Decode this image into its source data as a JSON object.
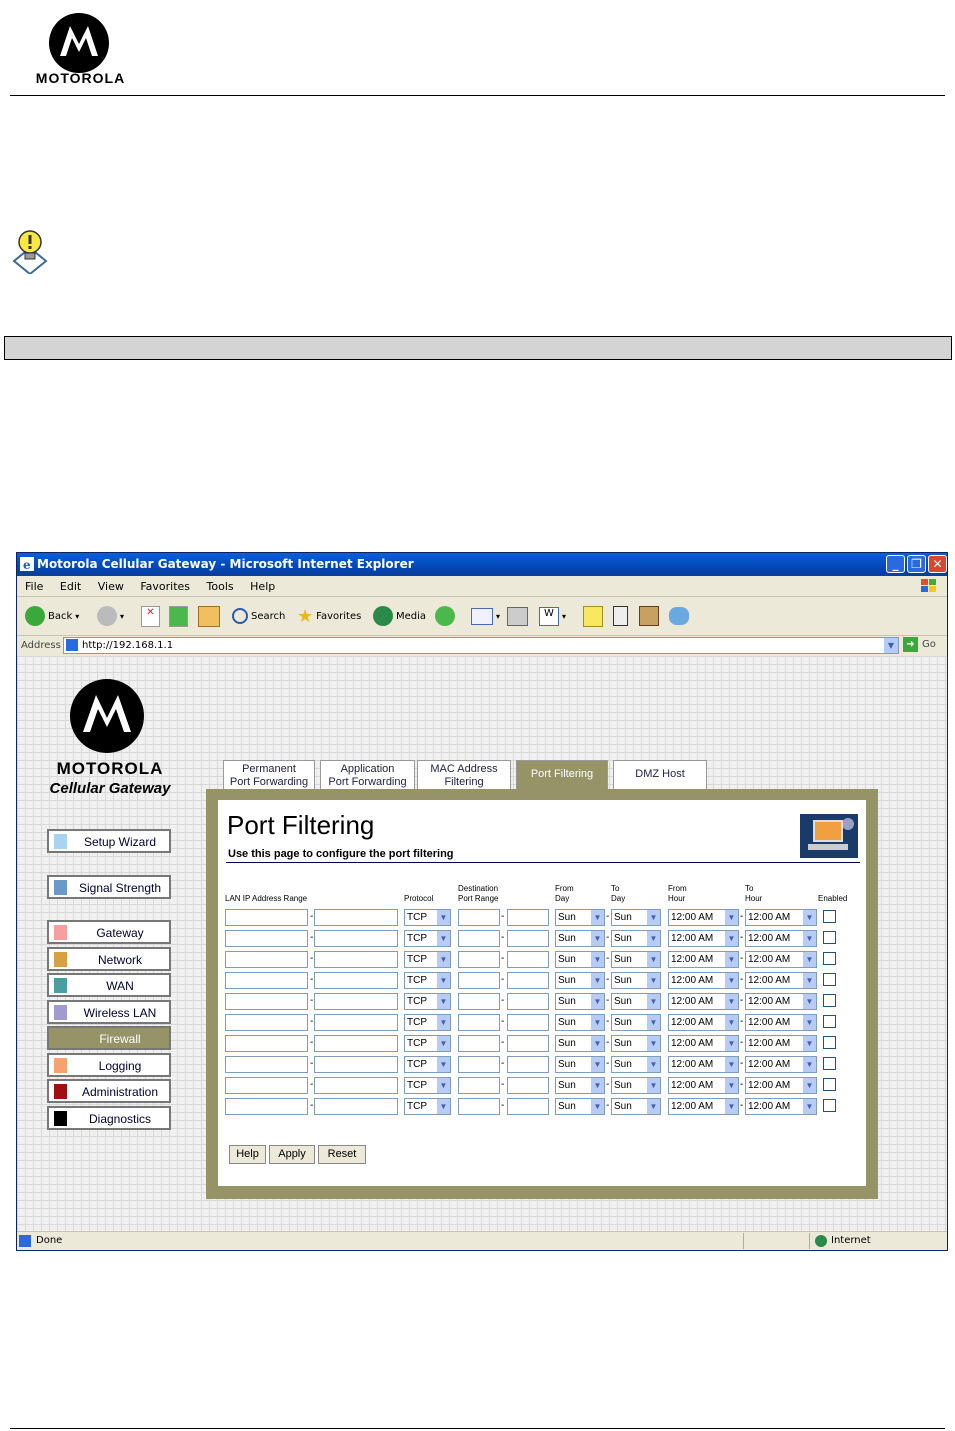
{
  "document": {
    "brand": "MOTOROLA"
  },
  "browser": {
    "title": "Motorola Cellular Gateway - Microsoft Internet Explorer",
    "menu": [
      "File",
      "Edit",
      "View",
      "Favorites",
      "Tools",
      "Help"
    ],
    "toolbar": {
      "back": "Back",
      "search": "Search",
      "favorites": "Favorites",
      "media": "Media"
    },
    "address_label": "Address",
    "address": "http://192.168.1.1",
    "go_label": "Go",
    "status": "Done",
    "zone": "Internet"
  },
  "sidebar": {
    "brand": "MOTOROLA",
    "subtitle": "Cellular Gateway",
    "items": [
      {
        "label": "Setup Wizard",
        "color": "#a8d4f2"
      },
      {
        "label": "Signal Strength",
        "color": "#6b9ac8"
      },
      {
        "label": "Gateway",
        "color": "#f4a0a0"
      },
      {
        "label": "Network",
        "color": "#d8a040"
      },
      {
        "label": "WAN",
        "color": "#4aa0a0"
      },
      {
        "label": "Wireless LAN",
        "color": "#a09ad0"
      },
      {
        "label": "Firewall",
        "color": "#969467"
      },
      {
        "label": "Logging",
        "color": "#f8a070"
      },
      {
        "label": "Administration",
        "color": "#a01010"
      },
      {
        "label": "Diagnostics",
        "color": "#000000"
      }
    ],
    "active": "Firewall"
  },
  "tabs": [
    {
      "line1": "Permanent",
      "line2": "Port Forwarding"
    },
    {
      "line1": "Application",
      "line2": "Port Forwarding"
    },
    {
      "line1": "MAC Address",
      "line2": "Filtering"
    },
    {
      "line1": "Port Filtering",
      "line2": ""
    },
    {
      "line1": "DMZ Host",
      "line2": ""
    }
  ],
  "page": {
    "title": "Port Filtering",
    "description": "Use this page to configure the port filtering",
    "columns": {
      "lan_ip": "LAN IP Address Range",
      "protocol": "Protocol",
      "dest1": "Destination",
      "dest2": "Port Range",
      "from_day1": "From",
      "from_day2": "Day",
      "to_day1": "To",
      "to_day2": "Day",
      "from_hour1": "From",
      "from_hour2": "Hour",
      "to_hour1": "To",
      "to_hour2": "Hour",
      "enabled": "Enabled"
    },
    "row_count": 10,
    "defaults": {
      "protocol": "TCP",
      "from_day": "Sun",
      "to_day": "Sun",
      "from_hour": "12:00 AM",
      "to_hour": "12:00 AM",
      "enabled": false
    },
    "buttons": {
      "help": "Help",
      "apply": "Apply",
      "reset": "Reset"
    }
  }
}
